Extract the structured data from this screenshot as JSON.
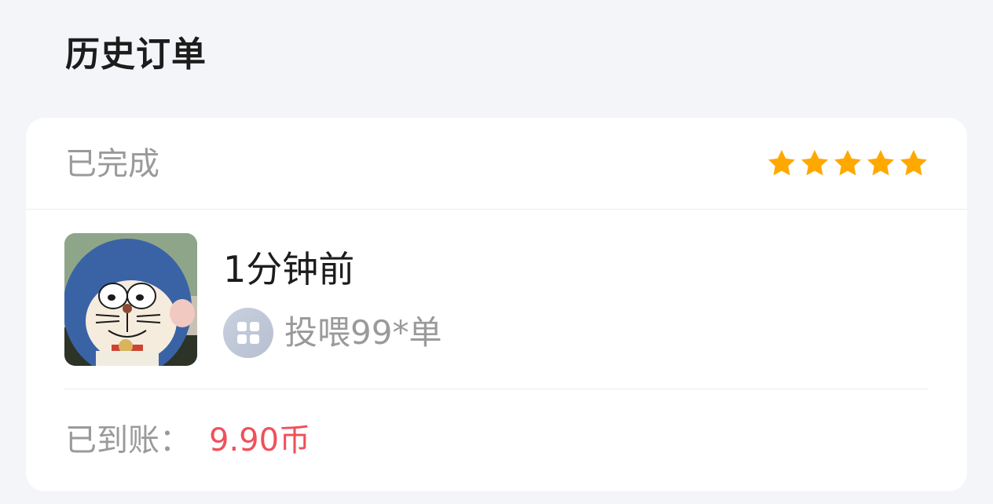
{
  "page": {
    "title": "历史订单"
  },
  "order": {
    "status": "已完成",
    "rating": 5,
    "rating_max": 5,
    "time": "1分钟前",
    "service": "投喂99*单",
    "paid_label": "已到账：",
    "paid_amount": "9.90币"
  },
  "icons": {
    "star": "star-icon",
    "service": "grid-icon",
    "avatar": "cartoon-cat-avatar"
  },
  "colors": {
    "background": "#f4f5f9",
    "card": "#ffffff",
    "star": "#ffa800",
    "amount": "#f0505a",
    "muted_text": "#9a9a9a",
    "primary_text": "#1c1c1c"
  }
}
